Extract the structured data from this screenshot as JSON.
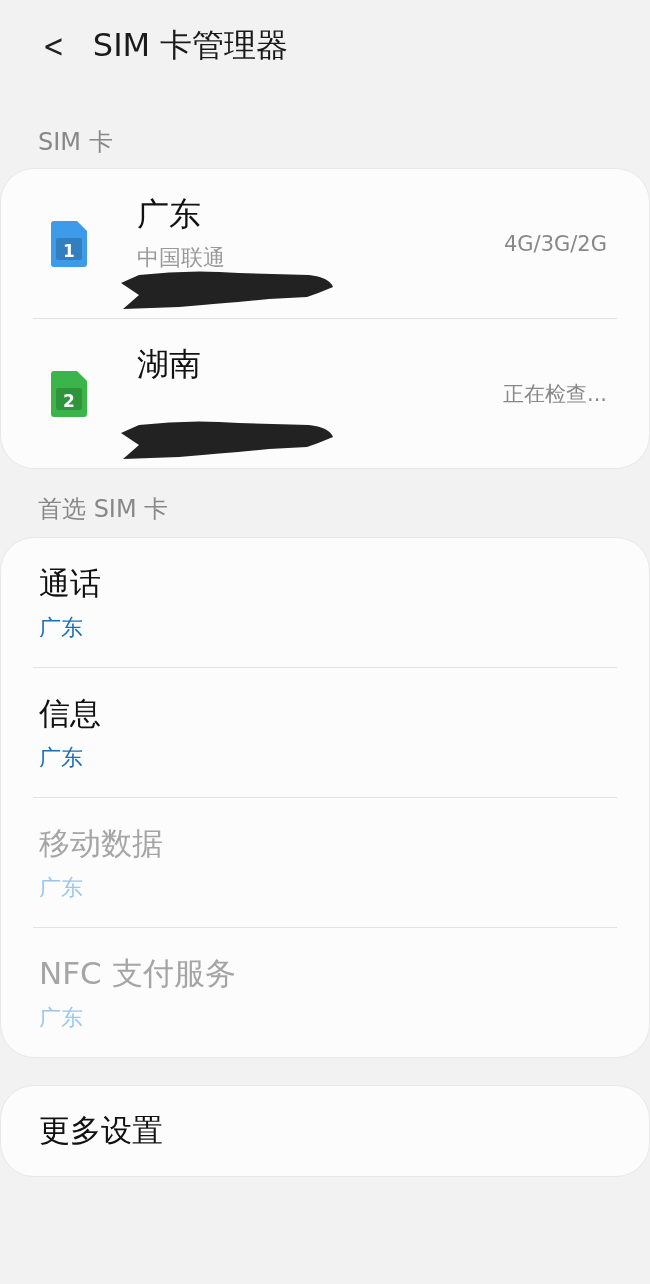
{
  "header": {
    "back_icon": "<",
    "title": "SIM 卡管理器"
  },
  "sim_section": {
    "title": "SIM 卡",
    "cards": [
      {
        "slot": "1",
        "color": "#3d9be9",
        "name": "广东",
        "carrier": "中国联通",
        "network": "4G/3G/2G",
        "number_redacted": true
      },
      {
        "slot": "2",
        "color": "#3bb54a",
        "name": "湖南",
        "network": "正在检查...",
        "number_redacted": true
      }
    ]
  },
  "preferred_section": {
    "title": "首选 SIM 卡",
    "items": [
      {
        "title": "通话",
        "value": "广东",
        "disabled": false
      },
      {
        "title": "信息",
        "value": "广东",
        "disabled": false
      },
      {
        "title": "移动数据",
        "value": "广东",
        "disabled": true
      },
      {
        "title": "NFC 支付服务",
        "value": "广东",
        "disabled": true
      }
    ]
  },
  "more": {
    "title": "更多设置"
  }
}
